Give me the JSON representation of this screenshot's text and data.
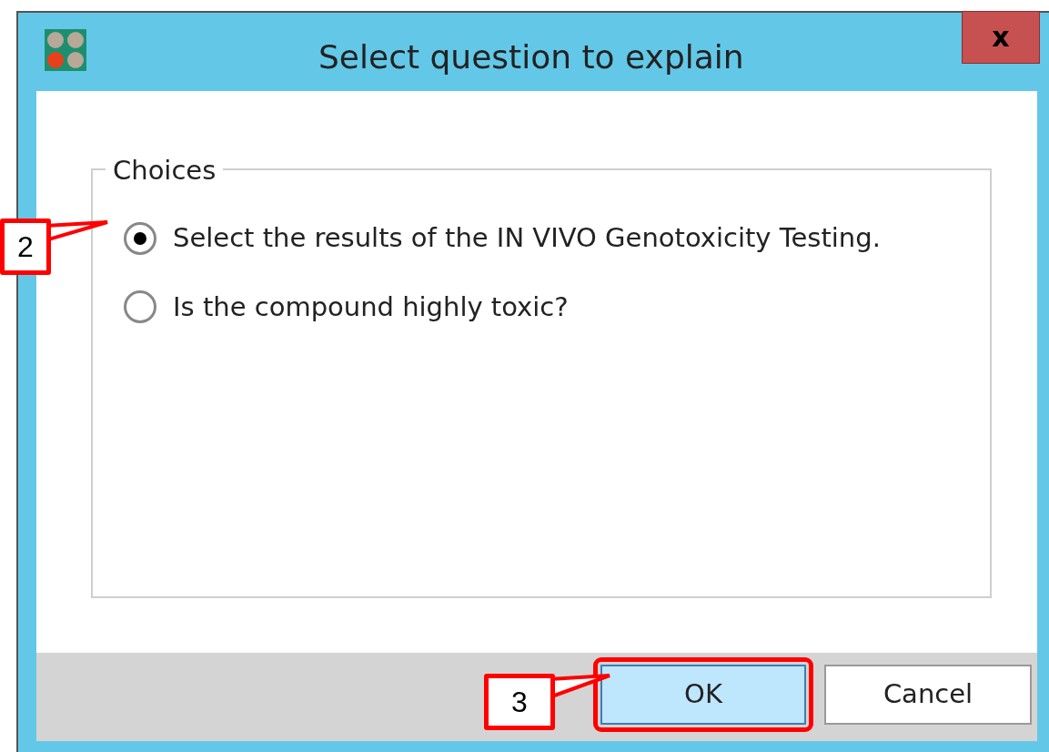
{
  "window": {
    "title": "Select question to explain",
    "close_label": "x"
  },
  "choices_group": {
    "label": "Choices",
    "options": [
      {
        "label": "Select the results of the IN VIVO Genotoxicity Testing.",
        "selected": true
      },
      {
        "label": "Is the compound highly toxic?",
        "selected": false
      }
    ]
  },
  "buttons": [
    {
      "label": "OK",
      "default": true,
      "highlighted": true
    },
    {
      "label": "Cancel",
      "default": false,
      "highlighted": false
    }
  ],
  "annotations": [
    {
      "label": "2"
    },
    {
      "label": "3"
    }
  ]
}
